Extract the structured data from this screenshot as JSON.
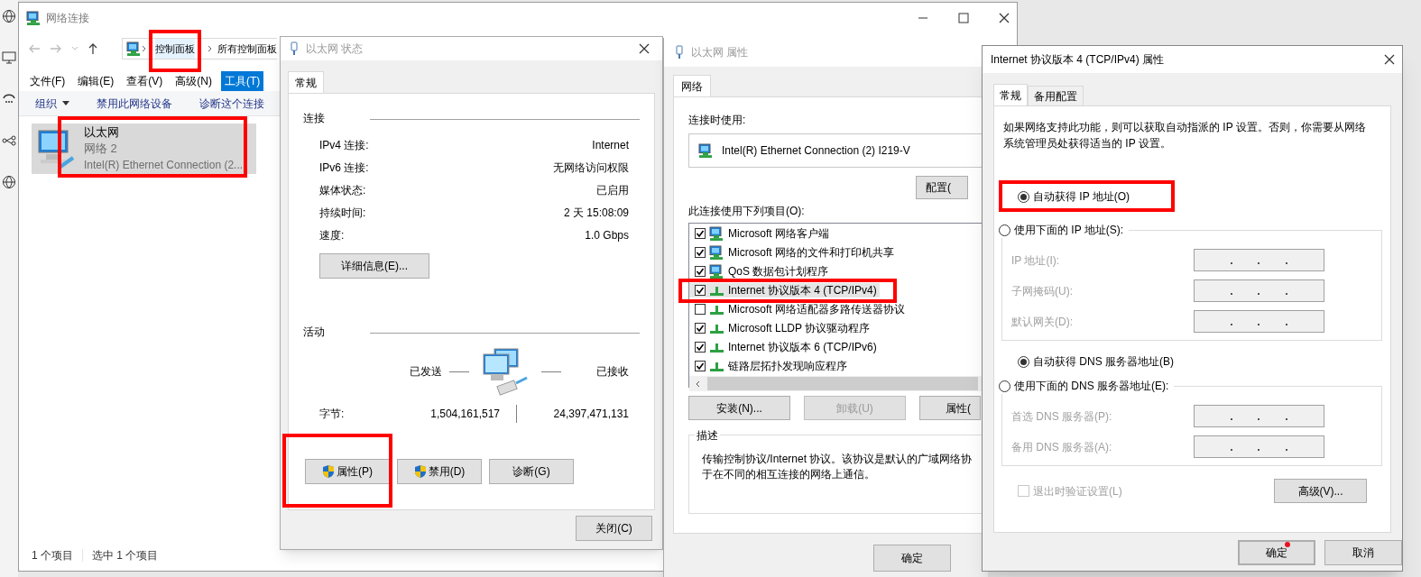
{
  "explorer": {
    "title": "网络连接",
    "breadcrumbs": [
      {
        "label": "控制面板",
        "highlighted": true
      },
      {
        "label": "所有控制面板",
        "highlighted": false
      }
    ],
    "menu": [
      {
        "label": "文件(F)",
        "selected": false
      },
      {
        "label": "编辑(E)",
        "selected": false
      },
      {
        "label": "查看(V)",
        "selected": false
      },
      {
        "label": "高级(N)",
        "selected": false
      },
      {
        "label": "工具(T)",
        "selected": true
      }
    ],
    "commands": [
      {
        "label": "组织",
        "dropdown": true
      },
      {
        "label": "禁用此网络设备",
        "dropdown": false
      },
      {
        "label": "诊断这个连接",
        "dropdown": false
      }
    ],
    "items": [
      {
        "name": "以太网",
        "network": "网络 2",
        "device": "Intel(R) Ethernet Connection (2...",
        "selected": true
      }
    ],
    "status_bar": [
      "1 个项目",
      "选中 1 个项目"
    ]
  },
  "status_dialog": {
    "title": "以太网 状态",
    "tabs": [
      {
        "label": "常规",
        "selected": true
      }
    ],
    "connection": {
      "heading": "连接",
      "rows": [
        {
          "label": "IPv4 连接:",
          "value": "Internet"
        },
        {
          "label": "IPv6 连接:",
          "value": "无网络访问权限"
        },
        {
          "label": "媒体状态:",
          "value": "已启用"
        },
        {
          "label": "持续时间:",
          "value": "2 天 15:08:09"
        },
        {
          "label": "速度:",
          "value": "1.0 Gbps"
        }
      ]
    },
    "details_button": "详细信息(E)...",
    "activity": {
      "heading": "活动",
      "sent_label": "已发送",
      "received_label": "已接收",
      "bytes_label": "字节:",
      "bytes_sent": "1,504,161,517",
      "bytes_received": "24,397,471,131"
    },
    "buttons": [
      {
        "label": "属性(P)",
        "shield": true
      },
      {
        "label": "禁用(D)",
        "shield": true
      },
      {
        "label": "诊断(G)",
        "shield": false
      }
    ],
    "close_button": "关闭(C)"
  },
  "properties_dialog": {
    "title": "以太网 属性",
    "tabs": [
      {
        "label": "网络",
        "selected": true
      }
    ],
    "connect_using_label": "连接时使用:",
    "adapter": "Intel(R) Ethernet Connection (2) I219-V",
    "configure_button": "配置(",
    "items_label": "此连接使用下列项目(O):",
    "items": [
      {
        "kind": "client",
        "label": "Microsoft 网络客户端",
        "checked": true,
        "selected": false
      },
      {
        "kind": "client",
        "label": "Microsoft 网络的文件和打印机共享",
        "checked": true,
        "selected": false
      },
      {
        "kind": "client",
        "label": "QoS 数据包计划程序",
        "checked": true,
        "selected": false
      },
      {
        "kind": "protocol",
        "label": "Internet 协议版本 4 (TCP/IPv4)",
        "checked": true,
        "selected": true
      },
      {
        "kind": "protocol",
        "label": "Microsoft 网络适配器多路传送器协议",
        "checked": false,
        "selected": false
      },
      {
        "kind": "protocol",
        "label": "Microsoft LLDP 协议驱动程序",
        "checked": true,
        "selected": false
      },
      {
        "kind": "protocol",
        "label": "Internet 协议版本 6 (TCP/IPv6)",
        "checked": true,
        "selected": false
      },
      {
        "kind": "protocol",
        "label": "链路层拓扑发现响应程序",
        "checked": true,
        "selected": false
      }
    ],
    "buttons": [
      {
        "label": "安装(N)...",
        "disabled": false
      },
      {
        "label": "卸载(U)",
        "disabled": true
      },
      {
        "label": "属性(",
        "disabled": false
      }
    ],
    "description": {
      "heading": "描述",
      "lines": [
        "传输控制协议/Internet 协议。该协议是默认的广域网络协",
        "于在不同的相互连接的网络上通信。"
      ]
    },
    "ok_button": "确定"
  },
  "tcp_dialog": {
    "title": "Internet 协议版本 4 (TCP/IPv4) 属性",
    "tabs": [
      {
        "label": "常规",
        "selected": true
      },
      {
        "label": "备用配置",
        "selected": false
      }
    ],
    "intro": "如果网络支持此功能，则可以获取自动指派的 IP 设置。否则，你需要从网络系统管理员处获得适当的 IP 设置。",
    "ip_options": [
      {
        "label": "自动获得 IP 地址(O)",
        "selected": true
      },
      {
        "label": "使用下面的 IP 地址(S):",
        "selected": false
      }
    ],
    "ip_fields": [
      {
        "label": "IP 地址(I):",
        "disabled": true
      },
      {
        "label": "子网掩码(U):",
        "disabled": true
      },
      {
        "label": "默认网关(D):",
        "disabled": true
      }
    ],
    "dns_options": [
      {
        "label": "自动获得 DNS 服务器地址(B)",
        "selected": true
      },
      {
        "label": "使用下面的 DNS 服务器地址(E):",
        "selected": false
      }
    ],
    "dns_fields": [
      {
        "label": "首选 DNS 服务器(P):",
        "disabled": true
      },
      {
        "label": "备用 DNS 服务器(A):",
        "disabled": true
      }
    ],
    "validate": {
      "label": "退出时验证设置(L)",
      "checked": false,
      "disabled": true
    },
    "advanced_button": "高级(V)...",
    "ok_button": {
      "label": "确定",
      "focused": true
    },
    "cancel_button": "取消"
  }
}
